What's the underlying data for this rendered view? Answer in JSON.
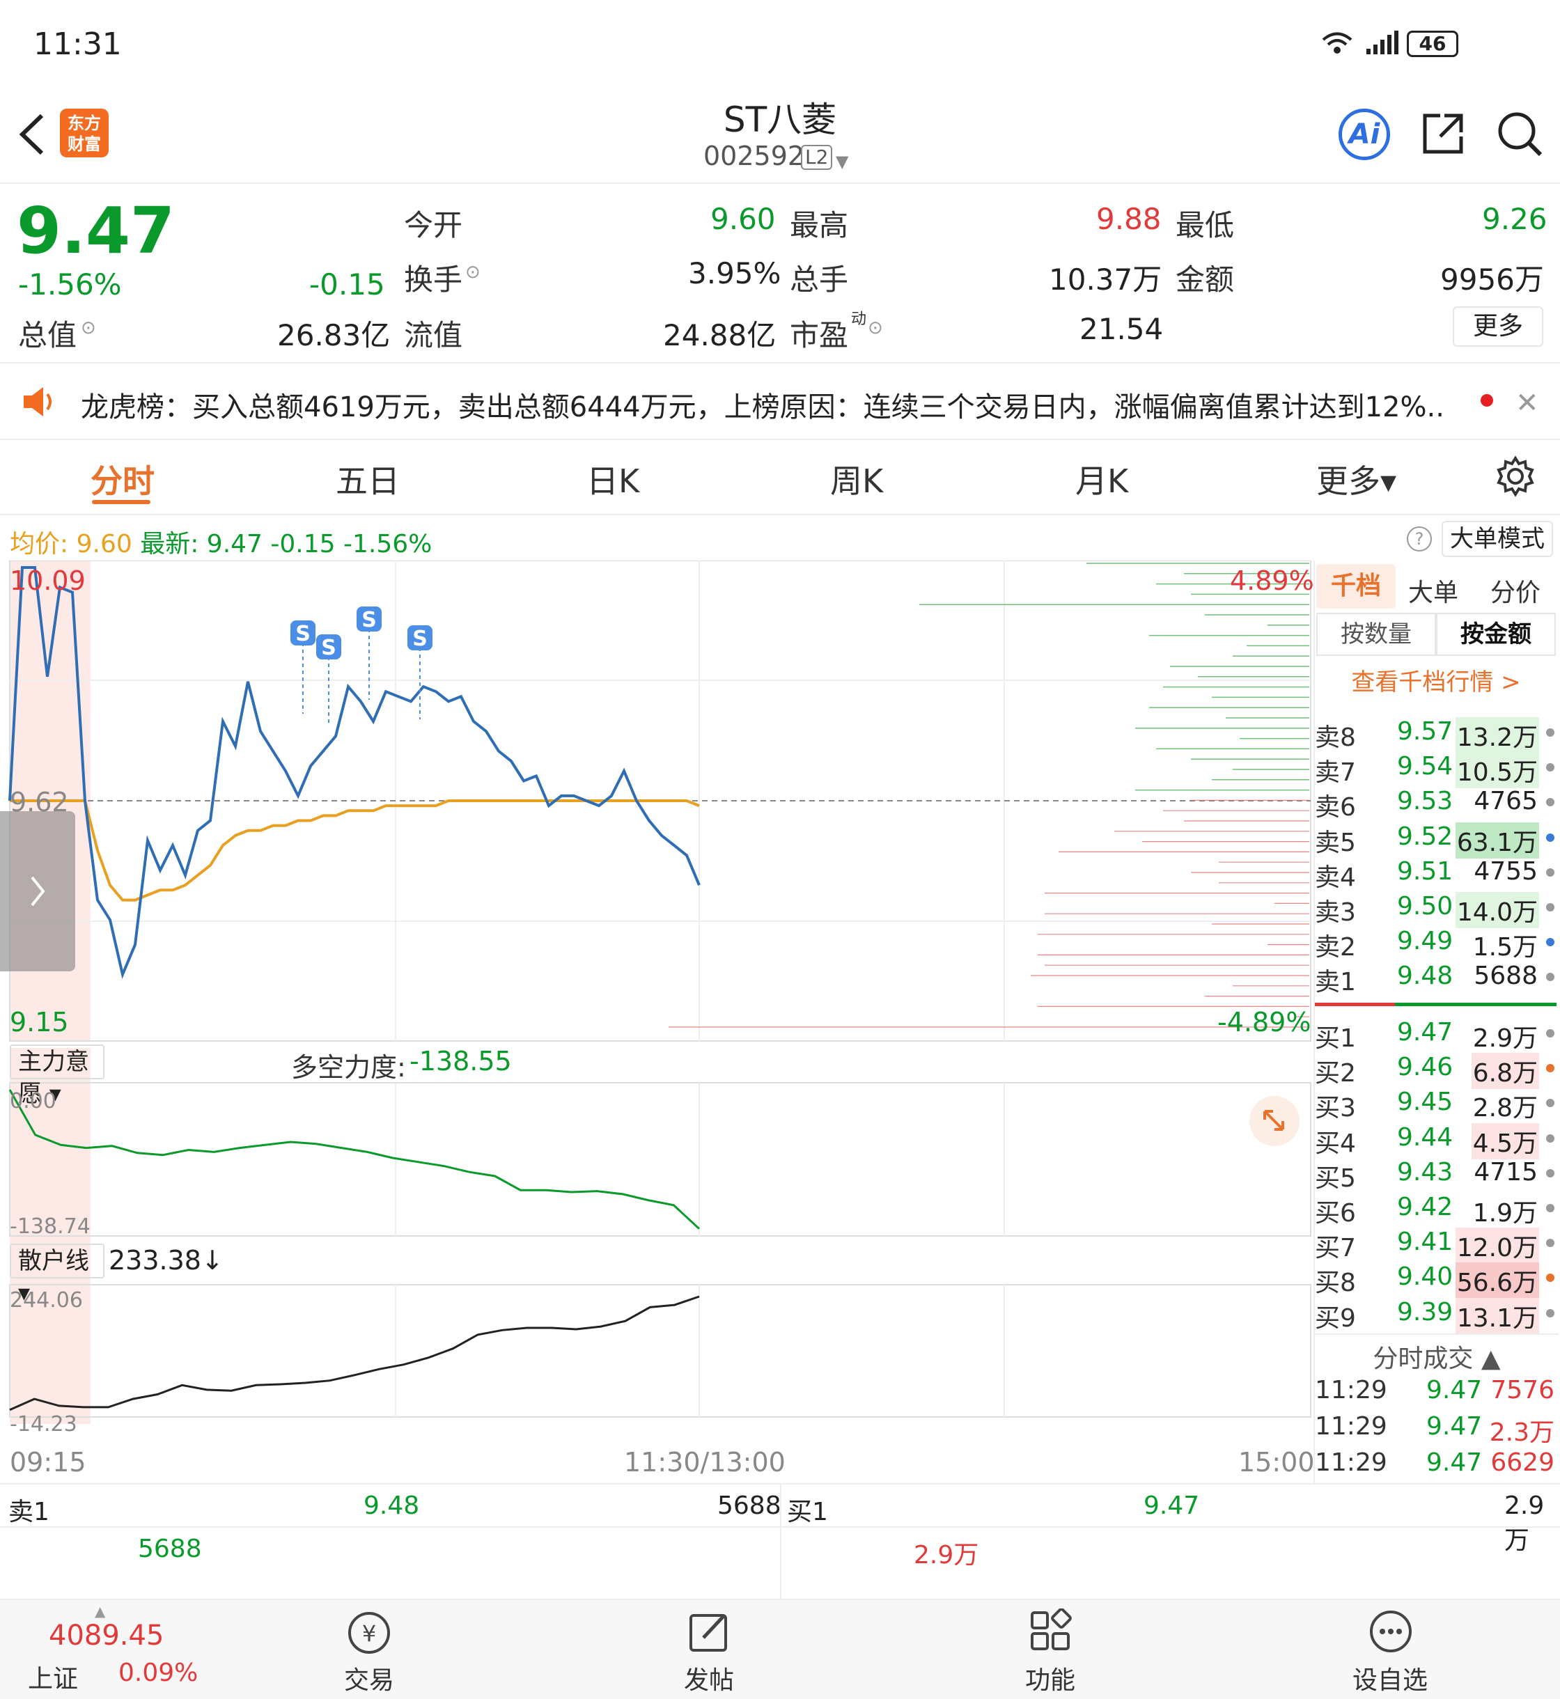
{
  "status_bar": {
    "time": "11:31",
    "signal": "46"
  },
  "header": {
    "title": "ST八菱",
    "code": "002592",
    "badge": "L2",
    "logo_line1": "东方",
    "logo_line2": "财富",
    "ai_label": "Ai"
  },
  "quote": {
    "price": "9.47",
    "change_pct": "-1.56%",
    "change": "-0.15",
    "total_value_label": "总值",
    "total_value": "26.83亿",
    "open_label": "今开",
    "open": "9.60",
    "turnover_label": "换手",
    "turnover": "3.95%",
    "float_label": "流值",
    "float_value": "24.88亿",
    "high_label": "最高",
    "high": "9.88",
    "volume_label": "总手",
    "volume": "10.37万",
    "pe_label": "市盈",
    "pe_sup": "动",
    "pe": "21.54",
    "low_label": "最低",
    "low": "9.26",
    "amount_label": "金额",
    "amount": "9956万",
    "more_button": "更多"
  },
  "notice": {
    "text": "龙虎榜：买入总额4619万元，卖出总额6444万元，上榜原因：连续三个交易日内，涨幅偏离值累计达到12%..."
  },
  "tabs": [
    {
      "label": "分时"
    },
    {
      "label": "五日"
    },
    {
      "label": "日K"
    },
    {
      "label": "周K"
    },
    {
      "label": "月K"
    },
    {
      "label": "更多▾"
    }
  ],
  "chart_info": {
    "avg_label": "均价:",
    "avg": "9.60",
    "latest_label": "最新:",
    "latest": "9.47",
    "change": "-0.15",
    "pct": "-1.56%",
    "big_order_mode": "大单模式"
  },
  "chart_data": [
    {
      "type": "line",
      "title": "",
      "y_top_label": "10.09",
      "y_mid_label": "9.62",
      "y_bottom_label": "9.15",
      "right_top_label": "4.89%",
      "right_bottom_label": "-4.89%",
      "ylim": [
        9.15,
        10.09
      ],
      "x_labels": [
        "09:15",
        "11:30/13:00",
        "15:00"
      ],
      "series": [
        {
          "values": [
            9.62,
            10.09,
            10.09,
            9.87,
            10.05,
            10.04,
            9.62,
            9.42,
            9.38,
            9.27,
            9.33,
            9.54,
            9.48,
            9.53,
            9.47,
            9.56,
            9.58,
            9.78,
            9.73,
            9.86,
            9.76,
            9.72,
            9.68,
            9.63,
            9.69,
            9.72,
            9.75,
            9.85,
            9.82,
            9.78,
            9.84,
            9.83,
            9.82,
            9.85,
            9.84,
            9.82,
            9.83,
            9.78,
            9.76,
            9.72,
            9.7,
            9.66,
            9.67,
            9.61,
            9.63,
            9.63,
            9.62,
            9.61,
            9.63,
            9.68,
            9.62,
            9.58,
            9.55,
            9.53,
            9.51,
            9.45
          ]
        },
        {
          "values": [
            9.62,
            9.62,
            9.62,
            9.62,
            9.62,
            9.62,
            9.62,
            9.52,
            9.45,
            9.42,
            9.42,
            9.43,
            9.44,
            9.44,
            9.45,
            9.47,
            9.49,
            9.53,
            9.55,
            9.56,
            9.56,
            9.57,
            9.57,
            9.58,
            9.58,
            9.59,
            9.59,
            9.6,
            9.6,
            9.6,
            9.61,
            9.61,
            9.61,
            9.61,
            9.61,
            9.62,
            9.62,
            9.62,
            9.62,
            9.62,
            9.62,
            9.62,
            9.62,
            9.62,
            9.62,
            9.62,
            9.62,
            9.62,
            9.62,
            9.62,
            9.62,
            9.62,
            9.62,
            9.62,
            9.62,
            9.61
          ]
        }
      ]
    },
    {
      "type": "line",
      "title": "主力意愿 ▾",
      "sub_label": "多空力度:",
      "sub_value": "-138.55",
      "y_top_label": "0.00",
      "y_bottom_label": "-138.74",
      "ylim": [
        -138.74,
        0
      ],
      "series": [
        {
          "values": [
            0,
            -45,
            -55,
            -58,
            -56,
            -63,
            -65,
            -60,
            -62,
            -58,
            -55,
            -52,
            -54,
            -58,
            -62,
            -68,
            -72,
            -76,
            -82,
            -86,
            -100,
            -100,
            -102,
            -101,
            -104,
            -110,
            -115,
            -138.55
          ]
        }
      ]
    },
    {
      "type": "line",
      "title": "散户线 ▾",
      "sub_value": "233.38↓",
      "y_top_label": "244.06",
      "y_bottom_label": "-14.23",
      "ylim": [
        -14.23,
        244.06
      ],
      "series": [
        {
          "values": [
            -14,
            10,
            -5,
            -8,
            -8,
            10,
            20,
            40,
            30,
            28,
            40,
            42,
            45,
            50,
            62,
            75,
            85,
            100,
            120,
            150,
            160,
            165,
            165,
            162,
            168,
            180,
            210,
            215,
            233.38
          ]
        }
      ]
    }
  ],
  "order_book": {
    "tabs": [
      "千档",
      "大单",
      "分价"
    ],
    "sub_tabs": [
      "按数量",
      "按金额"
    ],
    "link": "查看千档行情 >",
    "asks": [
      {
        "label": "卖8",
        "price": "9.57",
        "vol": "13.2万",
        "dot": "#999",
        "bar": "#dff5e0"
      },
      {
        "label": "卖7",
        "price": "9.54",
        "vol": "10.5万",
        "dot": "#999",
        "bar": "#dff5e0"
      },
      {
        "label": "卖6",
        "price": "9.53",
        "vol": "4765",
        "dot": "#999",
        "bar": ""
      },
      {
        "label": "卖5",
        "price": "9.52",
        "vol": "63.1万",
        "dot": "#3b7ad6",
        "bar": "#bfe9c4"
      },
      {
        "label": "卖4",
        "price": "9.51",
        "vol": "4755",
        "dot": "#999",
        "bar": ""
      },
      {
        "label": "卖3",
        "price": "9.50",
        "vol": "14.0万",
        "dot": "#999",
        "bar": "#dff5e0"
      },
      {
        "label": "卖2",
        "price": "9.49",
        "vol": "1.5万",
        "dot": "#3b7ad6",
        "bar": ""
      },
      {
        "label": "卖1",
        "price": "9.48",
        "vol": "5688",
        "dot": "#999",
        "bar": ""
      }
    ],
    "bids": [
      {
        "label": "买1",
        "price": "9.47",
        "vol": "2.9万",
        "dot": "#999",
        "bar": ""
      },
      {
        "label": "买2",
        "price": "9.46",
        "vol": "6.8万",
        "dot": "#e8712b",
        "bar": "#fde3e3"
      },
      {
        "label": "买3",
        "price": "9.45",
        "vol": "2.8万",
        "dot": "#999",
        "bar": ""
      },
      {
        "label": "买4",
        "price": "9.44",
        "vol": "4.5万",
        "dot": "#999",
        "bar": "#fde3e3"
      },
      {
        "label": "买5",
        "price": "9.43",
        "vol": "4715",
        "dot": "#999",
        "bar": ""
      },
      {
        "label": "买6",
        "price": "9.42",
        "vol": "1.9万",
        "dot": "#999",
        "bar": ""
      },
      {
        "label": "买7",
        "price": "9.41",
        "vol": "12.0万",
        "dot": "#999",
        "bar": "#fde3e3"
      },
      {
        "label": "买8",
        "price": "9.40",
        "vol": "56.6万",
        "dot": "#e8712b",
        "bar": "#f9c9c9"
      },
      {
        "label": "买9",
        "price": "9.39",
        "vol": "13.1万",
        "dot": "#999",
        "bar": "#fde3e3"
      }
    ],
    "trades_title": "分时成交 ▲",
    "trades": [
      {
        "time": "11:29",
        "price": "9.47",
        "vol": "7576"
      },
      {
        "time": "11:29",
        "price": "9.47",
        "vol": "2.3万"
      },
      {
        "time": "11:29",
        "price": "9.47",
        "vol": "6629"
      }
    ]
  },
  "bottom_quote": {
    "ask_label": "卖1",
    "ask_price": "9.48",
    "ask_vol": "5688",
    "ask_vol2": "5688",
    "bid_label": "买1",
    "bid_price": "9.47",
    "bid_vol": "2.9万",
    "bid_vol2": "2.9万"
  },
  "bottom_nav": {
    "index_value": "4089.45",
    "index_name": "上证",
    "index_pct": "0.09%",
    "items": [
      {
        "label": "交易"
      },
      {
        "label": "发帖"
      },
      {
        "label": "功能"
      },
      {
        "label": "设自选"
      }
    ]
  },
  "colors": {
    "up": "#e23a3a",
    "down": "#0a9a2c",
    "accent": "#e8712b",
    "line": "#2f6db5",
    "avg": "#e8a020"
  }
}
